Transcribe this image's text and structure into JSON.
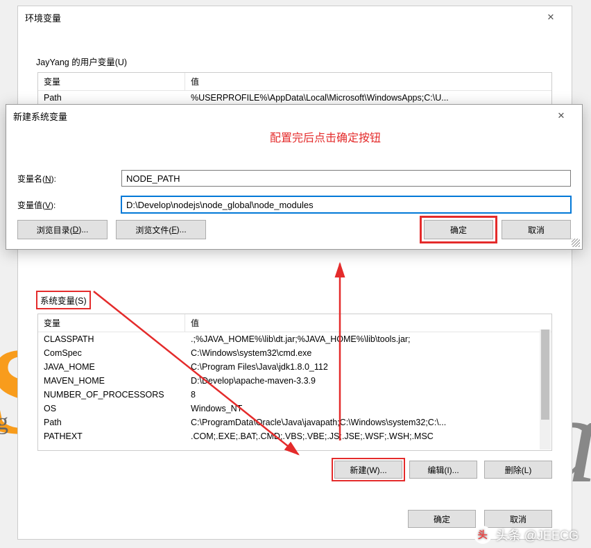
{
  "main_dialog": {
    "title": "环境变量",
    "user_group_label": "JayYang 的用户变量(U)",
    "sys_group_label": "系统变量(S)",
    "col_var": "变量",
    "col_val": "值",
    "user_rows": [
      {
        "var": "Path",
        "val": "%USERPROFILE%\\AppData\\Local\\Microsoft\\WindowsApps;C:\\U..."
      }
    ],
    "sys_rows": [
      {
        "var": "CLASSPATH",
        "val": ".;%JAVA_HOME%\\lib\\dt.jar;%JAVA_HOME%\\lib\\tools.jar;"
      },
      {
        "var": "ComSpec",
        "val": "C:\\Windows\\system32\\cmd.exe"
      },
      {
        "var": "JAVA_HOME",
        "val": "C:\\Program Files\\Java\\jdk1.8.0_112"
      },
      {
        "var": "MAVEN_HOME",
        "val": "D:\\Develop\\apache-maven-3.3.9"
      },
      {
        "var": "NUMBER_OF_PROCESSORS",
        "val": "8"
      },
      {
        "var": "OS",
        "val": "Windows_NT"
      },
      {
        "var": "Path",
        "val": "C:\\ProgramData\\Oracle\\Java\\javapath;C:\\Windows\\system32;C:\\..."
      },
      {
        "var": "PATHEXT",
        "val": ".COM;.EXE;.BAT;.CMD;.VBS;.VBE;.JS;.JSE;.WSF;.WSH;.MSC"
      }
    ],
    "btn_new": "新建(W)...",
    "btn_edit": "编辑(I)...",
    "btn_delete": "删除(L)",
    "btn_ok": "确定",
    "btn_cancel": "取消"
  },
  "new_dialog": {
    "title": "新建系统变量",
    "annotation": "配置完后点击确定按钮",
    "label_name": "变量名(N):",
    "label_value": "变量值(V):",
    "value_name": "NODE_PATH",
    "value_value": "D:\\Develop\\nodejs\\node_global\\node_modules",
    "btn_browse_dir": "浏览目录(D)...",
    "btn_browse_file": "浏览文件(F)...",
    "btn_ok": "确定",
    "btn_cancel": "取消"
  },
  "watermark": "头条 @JEECG"
}
